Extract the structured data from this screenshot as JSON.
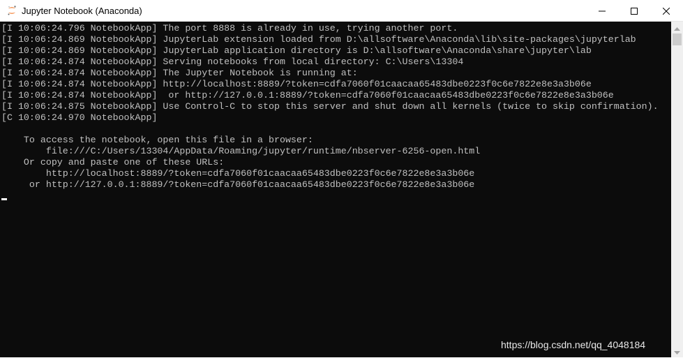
{
  "window": {
    "title": "Jupyter Notebook (Anaconda)",
    "app_icon": "jupyter-icon"
  },
  "controls": {
    "minimize_icon": "minimize-icon",
    "maximize_icon": "maximize-icon",
    "close_icon": "close-icon"
  },
  "console": {
    "lines": [
      "[I 10:06:24.796 NotebookApp] The port 8888 is already in use, trying another port.",
      "[I 10:06:24.869 NotebookApp] JupyterLab extension loaded from D:\\allsoftware\\Anaconda\\lib\\site-packages\\jupyterlab",
      "[I 10:06:24.869 NotebookApp] JupyterLab application directory is D:\\allsoftware\\Anaconda\\share\\jupyter\\lab",
      "[I 10:06:24.874 NotebookApp] Serving notebooks from local directory: C:\\Users\\13304",
      "[I 10:06:24.874 NotebookApp] The Jupyter Notebook is running at:",
      "[I 10:06:24.874 NotebookApp] http://localhost:8889/?token=cdfa7060f01caacaa65483dbe0223f0c6e7822e8e3a3b06e",
      "[I 10:06:24.874 NotebookApp]  or http://127.0.0.1:8889/?token=cdfa7060f01caacaa65483dbe0223f0c6e7822e8e3a3b06e",
      "[I 10:06:24.875 NotebookApp] Use Control-C to stop this server and shut down all kernels (twice to skip confirmation).",
      "[C 10:06:24.970 NotebookApp]",
      "",
      "    To access the notebook, open this file in a browser:",
      "        file:///C:/Users/13304/AppData/Roaming/jupyter/runtime/nbserver-6256-open.html",
      "    Or copy and paste one of these URLs:",
      "        http://localhost:8889/?token=cdfa7060f01caacaa65483dbe0223f0c6e7822e8e3a3b06e",
      "     or http://127.0.0.1:8889/?token=cdfa7060f01caacaa65483dbe0223f0c6e7822e8e3a3b06e"
    ]
  },
  "watermark": "https://blog.csdn.net/qq_4048184"
}
